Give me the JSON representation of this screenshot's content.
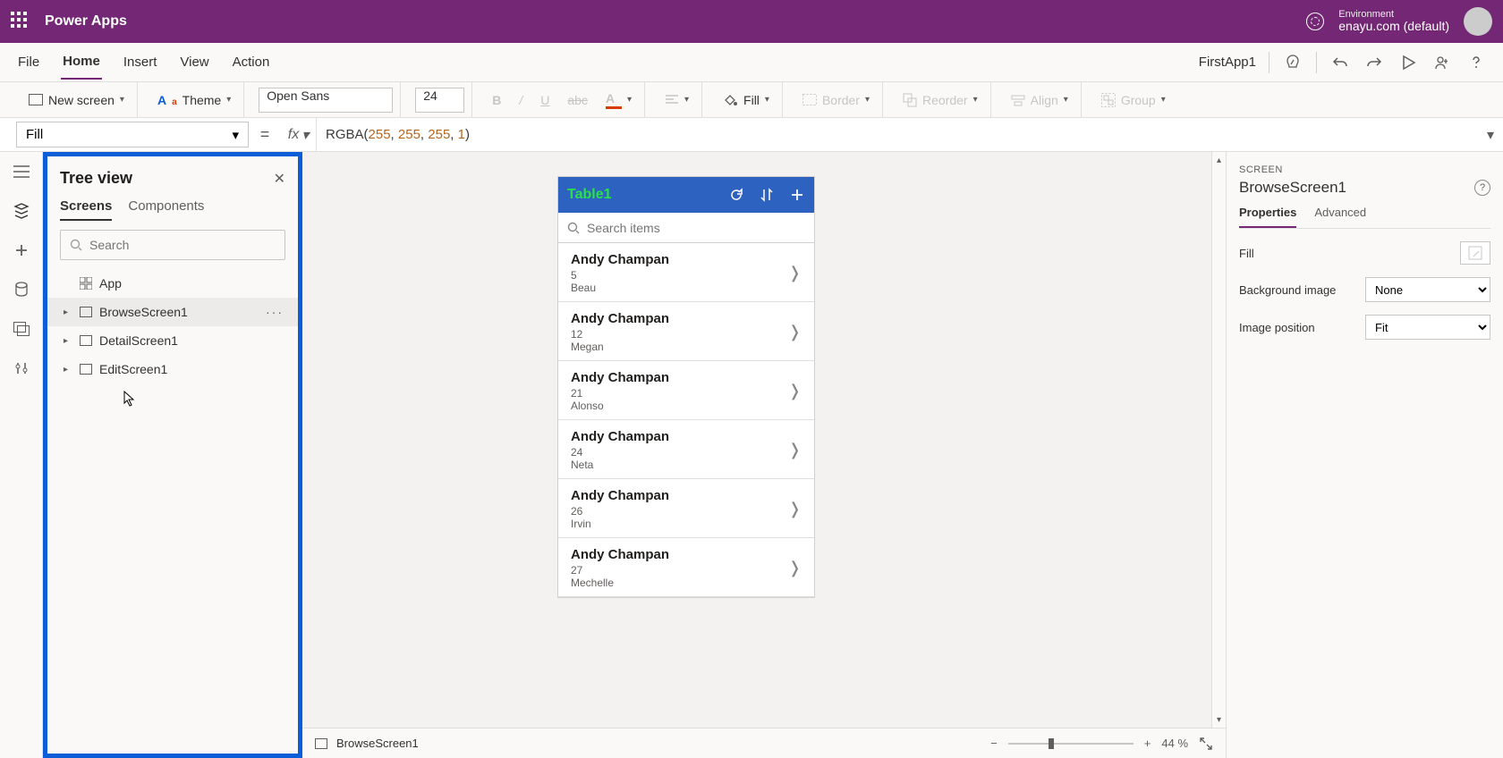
{
  "topbar": {
    "brand": "Power Apps",
    "env_label": "Environment",
    "env_value": "enayu.com (default)"
  },
  "menubar": {
    "items": [
      "File",
      "Home",
      "Insert",
      "View",
      "Action"
    ],
    "active_index": 1,
    "app_name": "FirstApp1"
  },
  "ribbon": {
    "new_screen": "New screen",
    "theme": "Theme",
    "font": "Open Sans",
    "size": "24",
    "fill": "Fill",
    "border": "Border",
    "reorder": "Reorder",
    "align": "Align",
    "group": "Group"
  },
  "formula": {
    "property": "Fill",
    "fx_label": "fx",
    "text_fn": "RGBA",
    "args": [
      "255",
      "255",
      "255",
      "1"
    ]
  },
  "tree": {
    "title": "Tree view",
    "tabs": [
      "Screens",
      "Components"
    ],
    "active_tab": 0,
    "search_placeholder": "Search",
    "app_node": "App",
    "nodes": [
      {
        "label": "BrowseScreen1",
        "selected": true
      },
      {
        "label": "DetailScreen1",
        "selected": false
      },
      {
        "label": "EditScreen1",
        "selected": false
      }
    ]
  },
  "phone": {
    "title": "Table1",
    "search_placeholder": "Search items",
    "items": [
      {
        "name": "Andy Champan",
        "num": "5",
        "sub": "Beau"
      },
      {
        "name": "Andy Champan",
        "num": "12",
        "sub": "Megan"
      },
      {
        "name": "Andy Champan",
        "num": "21",
        "sub": "Alonso"
      },
      {
        "name": "Andy Champan",
        "num": "24",
        "sub": "Neta"
      },
      {
        "name": "Andy Champan",
        "num": "26",
        "sub": "Irvin"
      },
      {
        "name": "Andy Champan",
        "num": "27",
        "sub": "Mechelle"
      }
    ]
  },
  "footer": {
    "breadcrumb": "BrowseScreen1",
    "zoom_value": "44",
    "zoom_unit": "%"
  },
  "properties": {
    "section_label": "SCREEN",
    "name": "BrowseScreen1",
    "tabs": [
      "Properties",
      "Advanced"
    ],
    "active_tab": 0,
    "rows": {
      "fill_label": "Fill",
      "bg_label": "Background image",
      "bg_value": "None",
      "imgpos_label": "Image position",
      "imgpos_value": "Fit"
    }
  }
}
